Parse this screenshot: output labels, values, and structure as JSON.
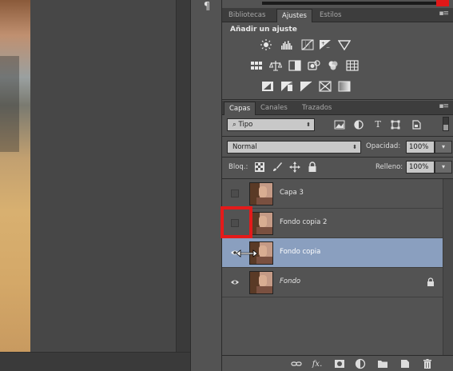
{
  "dock": {
    "paragraph_glyph": "¶"
  },
  "top_panel": {
    "tabs": [
      {
        "label": "Bibliotecas",
        "active": false
      },
      {
        "label": "Ajustes",
        "active": true
      },
      {
        "label": "Estilos",
        "active": false
      }
    ],
    "title": "Añadir un ajuste",
    "adjustment_icons": [
      "brightness-contrast-icon",
      "levels-icon",
      "curves-icon",
      "exposure-icon",
      "vibrance-icon",
      "hue-saturation-icon",
      "color-balance-icon",
      "black-white-icon",
      "photo-filter-icon",
      "channel-mixer-icon",
      "color-lookup-icon",
      "invert-icon",
      "posterize-icon",
      "threshold-icon",
      "selective-color-icon",
      "gradient-map-icon"
    ]
  },
  "layers_panel": {
    "tabs": [
      {
        "label": "Capas",
        "active": true
      },
      {
        "label": "Canales",
        "active": false
      },
      {
        "label": "Trazados",
        "active": false
      }
    ],
    "filter": {
      "value": "Tipo"
    },
    "blend_mode": "Normal",
    "opacity_label": "Opacidad:",
    "opacity_value": "100%",
    "lock_label": "Bloq.:",
    "fill_label": "Relleno:",
    "fill_value": "100%",
    "layers": [
      {
        "name": "Capa 3",
        "visible": false,
        "selected": false
      },
      {
        "name": "Fondo copia 2",
        "visible": false,
        "selected": false
      },
      {
        "name": "Fondo copia",
        "visible": true,
        "selected": true
      },
      {
        "name": "Fondo",
        "visible": true,
        "selected": false,
        "locked": true
      }
    ],
    "bottom_icons": [
      "link-icon",
      "fx-icon",
      "mask-icon",
      "adjustment-layer-icon",
      "folder-icon",
      "new-layer-icon",
      "trash-icon"
    ]
  },
  "colors": {
    "panel_bg": "#535353",
    "selected_row": "#8a9fbf",
    "highlight_red": "#e41a1a"
  }
}
